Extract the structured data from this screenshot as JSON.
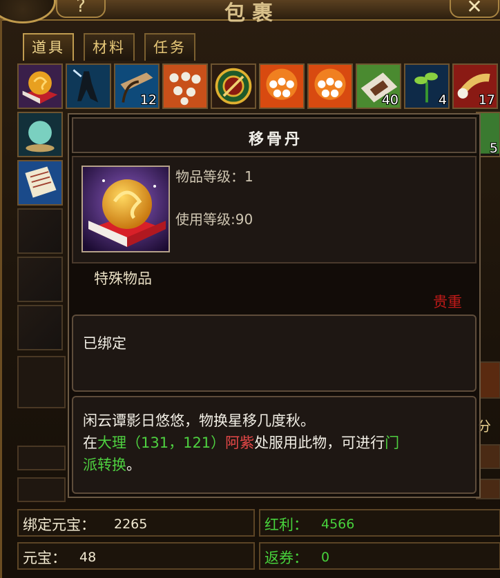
{
  "window": {
    "title": "包裹",
    "help_label": "?",
    "close_label": "✕"
  },
  "tabs": [
    {
      "label": "道具",
      "active": true
    },
    {
      "label": "材料",
      "active": false
    },
    {
      "label": "任务",
      "active": false
    }
  ],
  "grid": {
    "row1": [
      {
        "icon": "golden-pill-icon",
        "count": ""
      },
      {
        "icon": "shadow-figure-icon",
        "count": ""
      },
      {
        "icon": "scroll-bow-icon",
        "count": "12"
      },
      {
        "icon": "white-pearls-icon",
        "count": ""
      },
      {
        "icon": "compass-icon",
        "count": ""
      },
      {
        "icon": "fireball-pearls-icon",
        "count": ""
      },
      {
        "icon": "fireball-pearls-icon",
        "count": ""
      },
      {
        "icon": "green-paper-icon",
        "count": "40"
      },
      {
        "icon": "sprout-icon",
        "count": "4"
      },
      {
        "icon": "horn-icon",
        "count": "17"
      }
    ],
    "row2_right_count": "5",
    "right_side_label": "分"
  },
  "tooltip": {
    "item_name": "移骨丹",
    "item_level_label": "物品等级：",
    "item_level_value": "1",
    "use_level_label": "使用等级:",
    "use_level_value": "90",
    "category": "特殊物品",
    "rarity": "贵重",
    "bind_status": "已绑定",
    "desc_line1": "闲云谭影日悠悠，物换星移几度秋。",
    "desc_line2_pre": "在",
    "desc_location": "大理",
    "desc_coords": "（131，121）",
    "desc_npc": "阿紫",
    "desc_line2_mid": "处服用此物，可进行",
    "desc_action_a": "门",
    "desc_action_b": "派转换",
    "desc_end": "。"
  },
  "currency": {
    "bound_yuanbao_label": "绑定元宝：",
    "bound_yuanbao_value": "2265",
    "bonus_label": "红利：",
    "bonus_value": "4566",
    "yuanbao_label": "元宝：",
    "yuanbao_value": "48",
    "voucher_label": "返券：",
    "voucher_value": "0"
  },
  "colors": {
    "accent_gold": "#e7c878",
    "precious_red": "#c01a18",
    "highlight_green": "#4ed040",
    "npc_red": "#e84848"
  }
}
